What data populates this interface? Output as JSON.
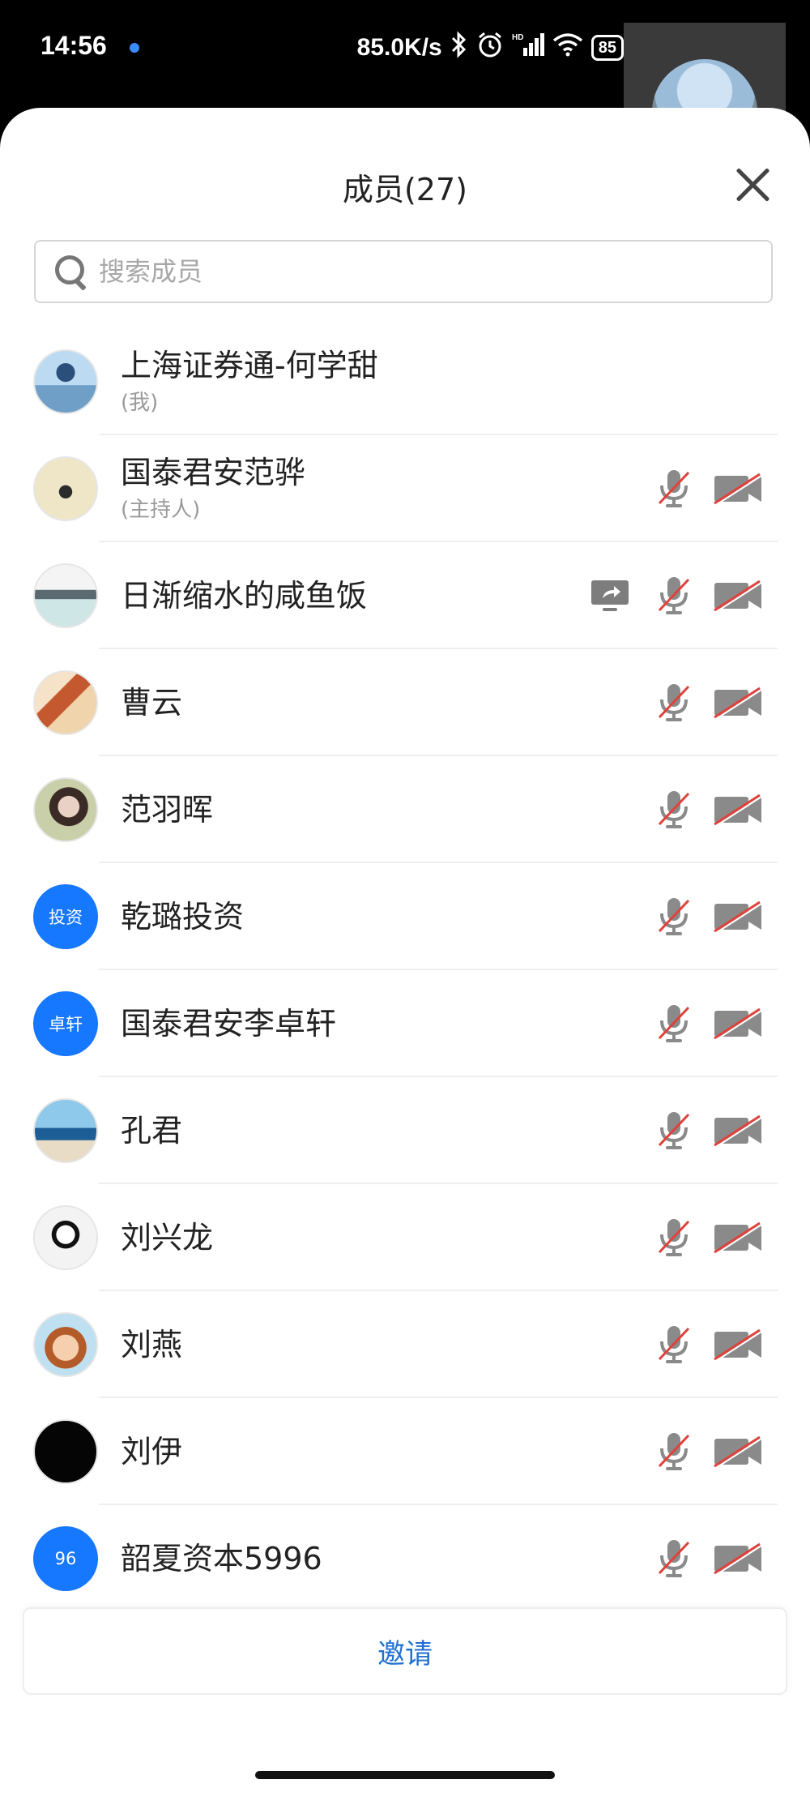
{
  "status_bar": {
    "time": "14:56",
    "speed": "85.0K/s",
    "battery": "85",
    "icons": [
      "bluetooth-icon",
      "alarm-icon",
      "hd-signal-icon",
      "wifi-icon",
      "battery-icon"
    ]
  },
  "panel": {
    "title": "成员(27)",
    "search_placeholder": "搜索成员",
    "invite_label": "邀请"
  },
  "colors": {
    "accent": "#1677ff",
    "invite_text": "#1f6fd1",
    "muted_slash": "#e0413a",
    "icon_gray": "#8a8a8a"
  },
  "members": [
    {
      "name": "上海证券通-何学甜",
      "role": "(我)",
      "avatar": "photo-sky"
    },
    {
      "name": "国泰君安范骅",
      "role": "(主持人)",
      "avatar": "photo-planet"
    },
    {
      "name": "日渐缩水的咸鱼饭",
      "role": "",
      "avatar": "photo-boat",
      "sharing": true
    },
    {
      "name": "曹云",
      "role": "",
      "avatar": "photo-room"
    },
    {
      "name": "范羽晖",
      "role": "",
      "avatar": "photo-girl"
    },
    {
      "name": "乾璐投资",
      "role": "",
      "avatar_text": "投资"
    },
    {
      "name": "国泰君安李卓轩",
      "role": "",
      "avatar_text": "卓轩"
    },
    {
      "name": "孔君",
      "role": "",
      "avatar": "photo-beach"
    },
    {
      "name": "刘兴龙",
      "role": "",
      "avatar": "photo-panda"
    },
    {
      "name": "刘燕",
      "role": "",
      "avatar": "photo-cartoon"
    },
    {
      "name": "刘伊",
      "role": "",
      "avatar": "photo-black"
    },
    {
      "name": "韶夏资本5996",
      "role": "",
      "avatar_text": "96"
    }
  ]
}
